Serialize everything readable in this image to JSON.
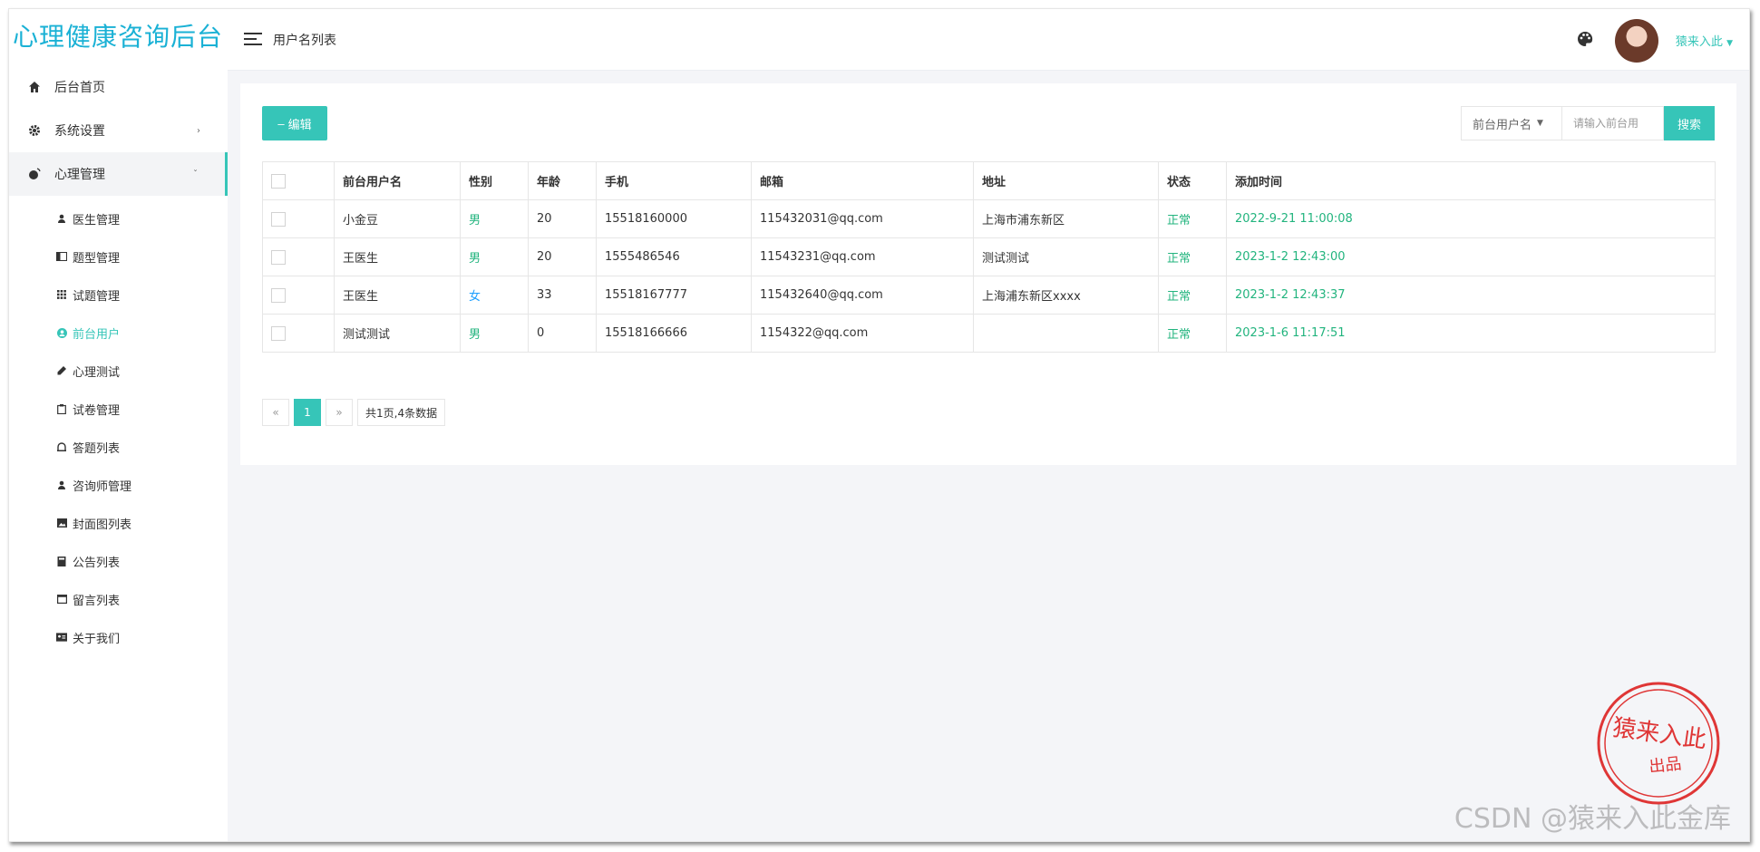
{
  "brand": "心理健康咨询后台",
  "header": {
    "page_title": "用户名列表",
    "user_name": "猿来入此"
  },
  "sidebar": {
    "items": [
      {
        "label": "后台首页",
        "icon": "home-icon"
      },
      {
        "label": "系统设置",
        "icon": "gear-icon"
      },
      {
        "label": "心理管理",
        "icon": "globe-icon"
      }
    ],
    "sub_items": [
      {
        "label": "医生管理",
        "icon": "user-icon"
      },
      {
        "label": "题型管理",
        "icon": "book-icon"
      },
      {
        "label": "试题管理",
        "icon": "grid-icon"
      },
      {
        "label": "前台用户",
        "icon": "user-circle-icon"
      },
      {
        "label": "心理测试",
        "icon": "pencil-icon"
      },
      {
        "label": "试卷管理",
        "icon": "clipboard-icon"
      },
      {
        "label": "答题列表",
        "icon": "bell-icon"
      },
      {
        "label": "咨询师管理",
        "icon": "user-icon"
      },
      {
        "label": "封面图列表",
        "icon": "image-icon"
      },
      {
        "label": "公告列表",
        "icon": "notebook-icon"
      },
      {
        "label": "留言列表",
        "icon": "window-icon"
      },
      {
        "label": "关于我们",
        "icon": "id-card-icon"
      }
    ]
  },
  "toolbar": {
    "edit_label": "编辑",
    "filter_label": "前台用户名",
    "search_placeholder": "请输入前台用",
    "search_button": "搜索"
  },
  "table": {
    "headers": [
      "前台用户名",
      "性别",
      "年龄",
      "手机",
      "邮箱",
      "地址",
      "状态",
      "添加时间"
    ],
    "rows": [
      {
        "name": "小金豆",
        "gender": "男",
        "age": "20",
        "phone": "15518160000",
        "email": "115432031@qq.com",
        "address": "上海市浦东新区",
        "status": "正常",
        "time": "2022-9-21 11:00:08"
      },
      {
        "name": "王医生",
        "gender": "男",
        "age": "20",
        "phone": "1555486546",
        "email": "11543231@qq.com",
        "address": "测试测试",
        "status": "正常",
        "time": "2023-1-2 12:43:00"
      },
      {
        "name": "王医生",
        "gender": "女",
        "age": "33",
        "phone": "15518167777",
        "email": "115432640@qq.com",
        "address": "上海浦东新区xxxx",
        "status": "正常",
        "time": "2023-1-2 12:43:37"
      },
      {
        "name": "测试测试",
        "gender": "男",
        "age": "0",
        "phone": "15518166666",
        "email": "1154322@qq.com",
        "address": "",
        "status": "正常",
        "time": "2023-1-6 11:17:51"
      }
    ]
  },
  "pagination": {
    "prev": "«",
    "current": "1",
    "next": "»",
    "info": "共1页,4条数据"
  },
  "watermark": {
    "seal_text": "猿来入此",
    "seal_sub": "出品",
    "csdn": "CSDN @猿来入此金库"
  },
  "colors": {
    "accent": "#36c5b8",
    "brand": "#1ab1d5",
    "male": "#22b47e",
    "female": "#1e9fff"
  }
}
